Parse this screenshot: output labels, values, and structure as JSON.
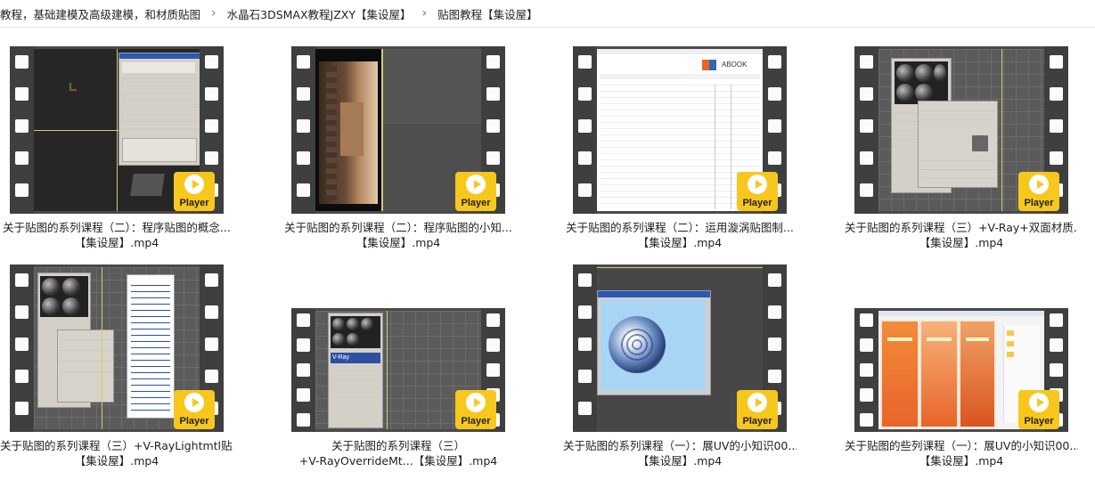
{
  "breadcrumb": [
    "教程，基础建模及高级建模，和材质贴图",
    "水晶石3DSMAX教程JZXY【集设屋】",
    "贴图教程【集设屋】"
  ],
  "player_badge": "Player",
  "files": [
    {
      "line1": "关于贴图的系列课程（二）：程序贴图的概念...",
      "line2": "【集设屋】.mp4"
    },
    {
      "line1": "关于贴图的系列课程（二）：程序贴图的小知...",
      "line2": "【集设屋】.mp4"
    },
    {
      "line1": "关于贴图的系列课程（二）：运用漩涡贴图制...",
      "line2": "【集设屋】.mp4"
    },
    {
      "line1": "关于贴图的系列课程（三）+V-Ray+双面材质...",
      "line2": "【集设屋】.mp4"
    },
    {
      "line1": "关于贴图的系列课程（三）+V-RayLightmtl贴...",
      "line2": "【集设屋】.mp4"
    },
    {
      "line1": "关于贴图的系列课程（三）",
      "line2": "+V-RayOverrideMt...【集设屋】.mp4"
    },
    {
      "line1": "关于贴图的系列课程（一）：展UV的小知识00...",
      "line2": "【集设屋】.mp4"
    },
    {
      "line1": "关于贴图的些列课程（一）：展UV的小知识00...",
      "line2": "【集设屋】.mp4"
    }
  ],
  "thumb_texts": {
    "web_logo": "ABOOK",
    "vray_logo": "V-Ray"
  },
  "colors": {
    "film": "#3f3f3f",
    "hole": "#fbfbfb",
    "player": "#f7c71e",
    "viewport_border": "#d6c86a",
    "orange_panel": "#e8642a"
  }
}
